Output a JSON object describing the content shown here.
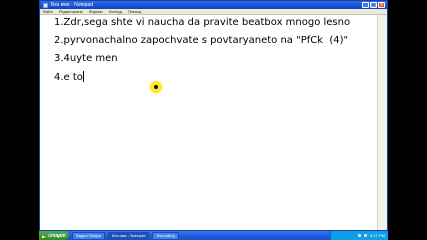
{
  "window": {
    "title": "Без име - Notepad",
    "buttons": {
      "minimize": "_",
      "maximize": "□",
      "close": "×"
    }
  },
  "menu": [
    "Файл",
    "Редактиране",
    "Формат",
    "Изглед",
    "Помощ"
  ],
  "editor": {
    "lines": [
      "1.Zdr,sega shte vi naucha da pravite beatbox mnogo lesno",
      "2.pyrvonachalno zapochvate s povtaryaneto na \"PfCk  (4)\"",
      "3.4uyte men",
      "4.e to"
    ]
  },
  "taskbar": {
    "start_label": "старт",
    "tasks": [
      "Видео Опции",
      "Без име - Notepad",
      "Recording"
    ],
    "clock": "5:17 PM"
  },
  "colors": {
    "cursor_highlight": "#ffe92e",
    "titlebar": "#1553d8"
  }
}
